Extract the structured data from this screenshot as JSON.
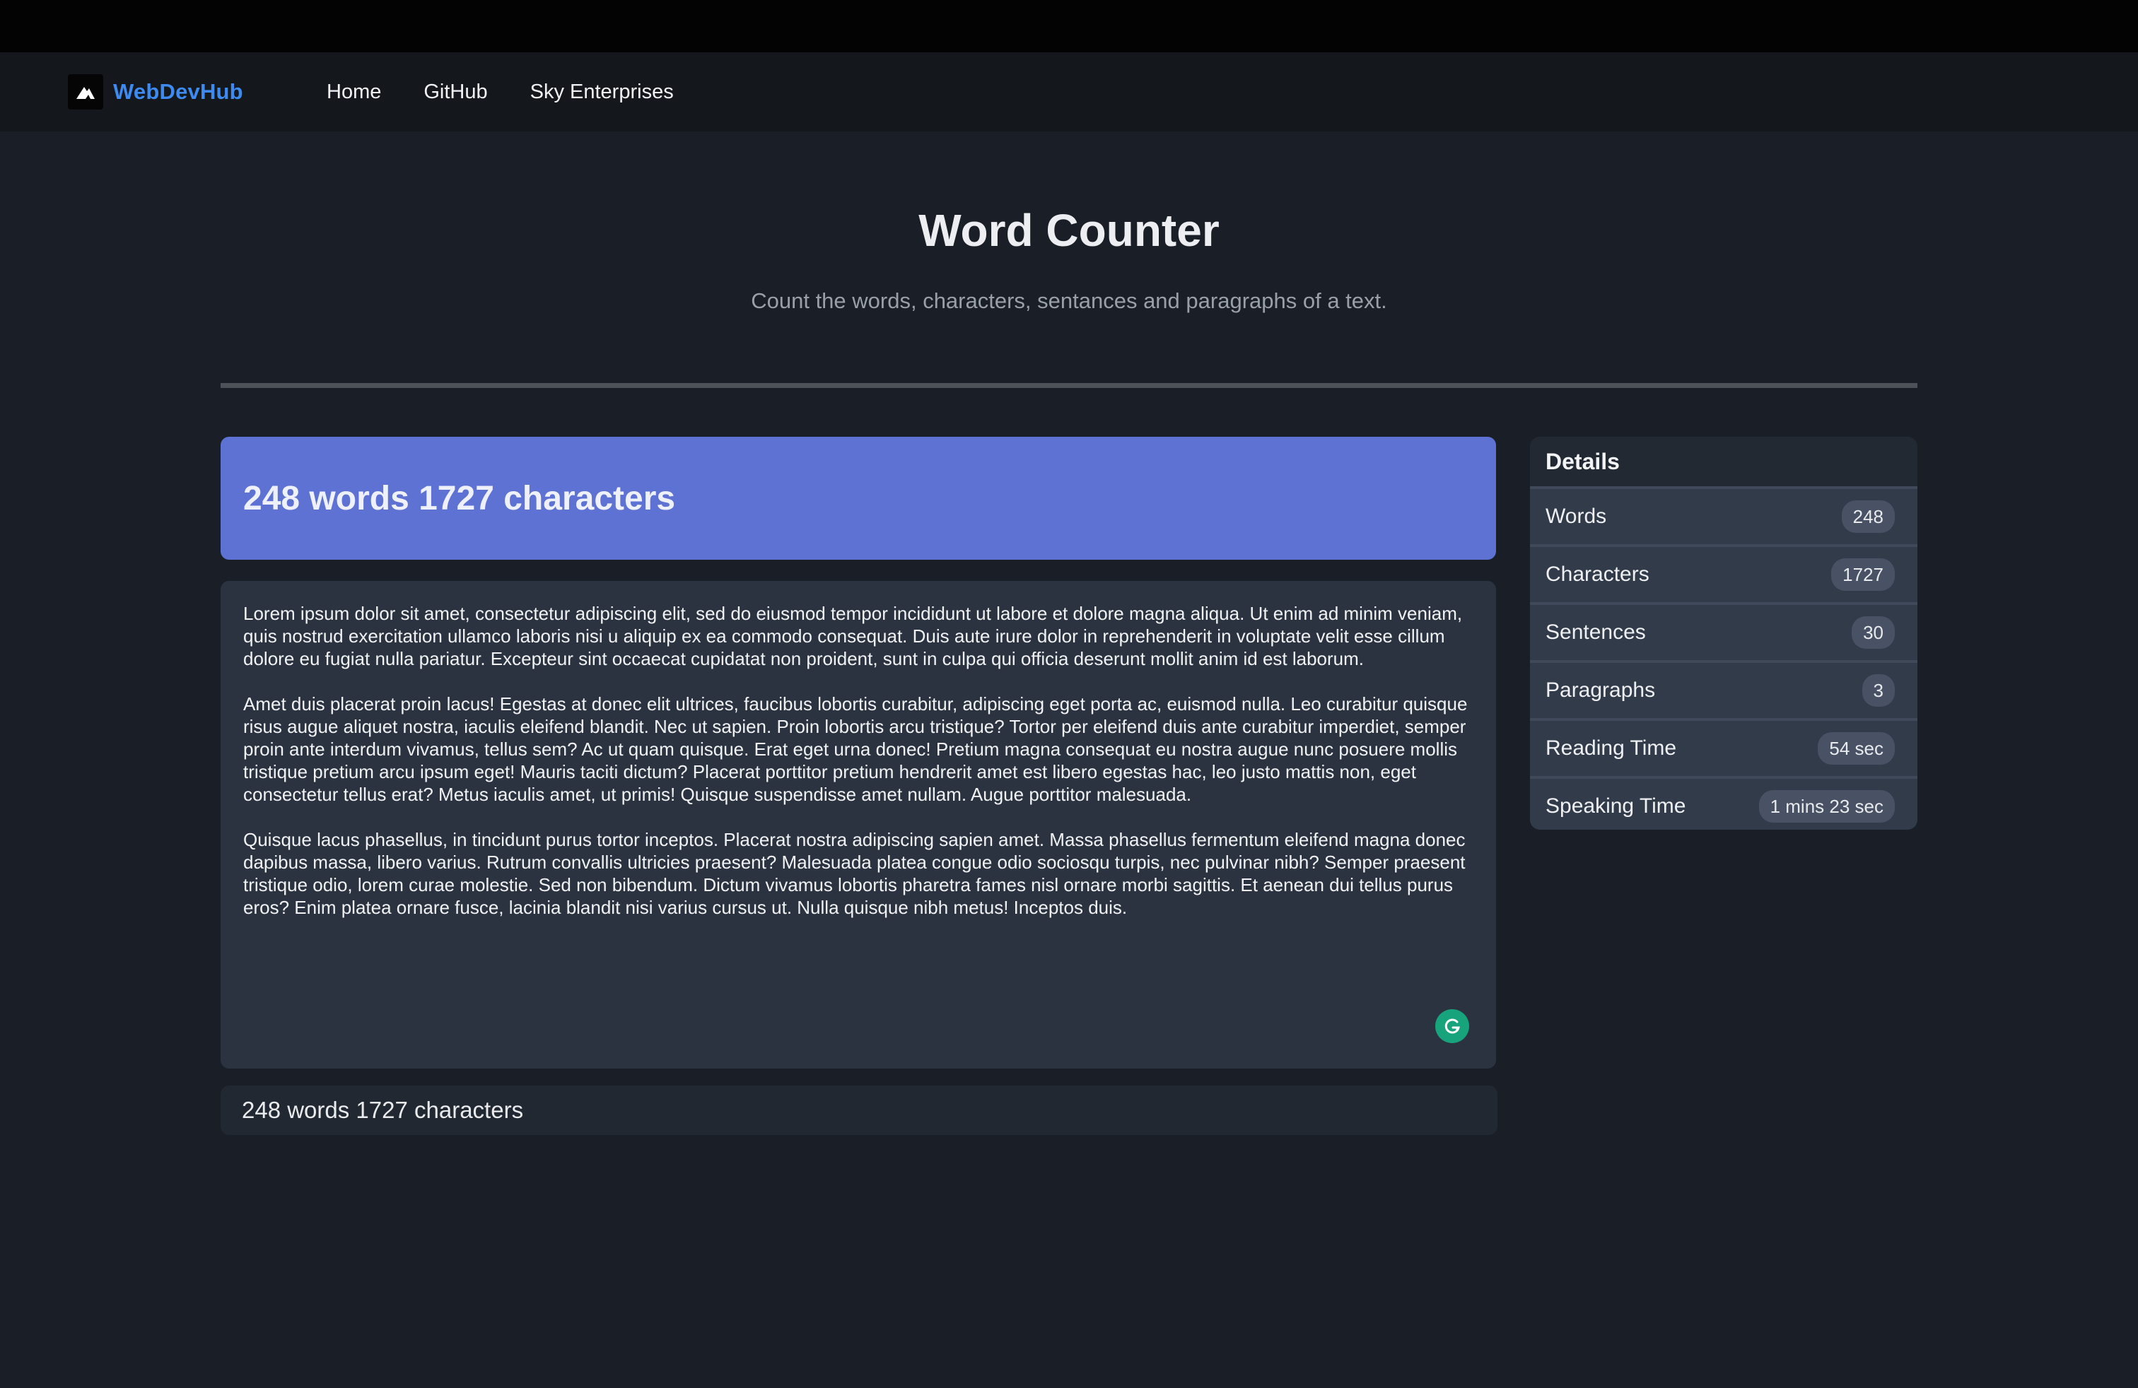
{
  "navbar": {
    "brand": "WebDevHub",
    "links": [
      "Home",
      "GitHub",
      "Sky Enterprises"
    ]
  },
  "page": {
    "title": "Word Counter",
    "subtitle": "Count the words, characters, sentances and paragraphs of a text."
  },
  "summary": {
    "banner_text": "248 words 1727 characters",
    "footer_text": "248 words 1727 characters"
  },
  "editor": {
    "text": "Lorem ipsum dolor sit amet, consectetur adipiscing elit, sed do eiusmod tempor incididunt ut labore et dolore magna aliqua. Ut enim ad minim veniam, quis nostrud exercitation ullamco laboris nisi u aliquip ex ea commodo consequat. Duis aute irure dolor in reprehenderit in voluptate velit esse cillum dolore eu fugiat nulla pariatur. Excepteur sint occaecat cupidatat non proident, sunt in culpa qui officia deserunt mollit anim id est laborum.\n\nAmet duis placerat proin lacus! Egestas at donec elit ultrices, faucibus lobortis curabitur, adipiscing eget porta ac, euismod nulla. Leo curabitur quisque risus augue aliquet nostra, iaculis eleifend blandit. Nec ut sapien. Proin lobortis arcu tristique? Tortor per eleifend duis ante curabitur imperdiet, semper proin ante interdum vivamus, tellus sem? Ac ut quam quisque. Erat eget urna donec! Pretium magna consequat eu nostra augue nunc posuere mollis tristique pretium arcu ipsum eget! Mauris taciti dictum? Placerat porttitor pretium hendrerit amet est libero egestas hac, leo justo mattis non, eget consectetur tellus erat? Metus iaculis amet, ut primis! Quisque suspendisse amet nullam. Augue porttitor malesuada.\n\nQuisque lacus phasellus, in tincidunt purus tortor inceptos. Placerat nostra adipiscing sapien amet. Massa phasellus fermentum eleifend magna donec dapibus massa, libero varius. Rutrum convallis ultricies praesent? Malesuada platea congue odio sociosqu turpis, nec pulvinar nibh? Semper praesent tristique odio, lorem curae molestie. Sed non bibendum. Dictum vivamus lobortis pharetra fames nisl ornare morbi sagittis. Et aenean dui tellus purus eros? Enim platea ornare fusce, lacinia blandit nisi varius cursus ut. Nulla quisque nibh metus! Inceptos duis."
  },
  "details": {
    "title": "Details",
    "rows": [
      {
        "label": "Words",
        "value": "248"
      },
      {
        "label": "Characters",
        "value": "1727"
      },
      {
        "label": "Sentences",
        "value": "30"
      },
      {
        "label": "Paragraphs",
        "value": "3"
      },
      {
        "label": "Reading Time",
        "value": "54 sec"
      },
      {
        "label": "Speaking Time",
        "value": "1 mins 23 sec"
      }
    ]
  },
  "icons": {
    "brand_logo": "mountain-logo-icon",
    "grammar": "grammarly-g-icon"
  },
  "colors": {
    "brand": "#3d8bf0",
    "banner": "#5e72d4",
    "grammar_icon": "#17a37c"
  }
}
